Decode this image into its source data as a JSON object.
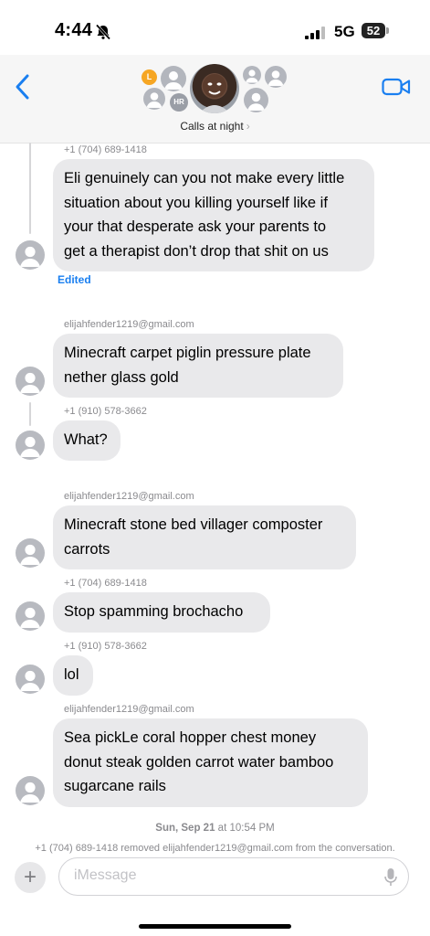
{
  "status_bar": {
    "time": "4:44",
    "network": "5G",
    "battery": "52"
  },
  "header": {
    "group_name": "Calls at night",
    "chevron": "›",
    "initials_badge_1": "L",
    "initials_badge_2": "HR"
  },
  "messages": [
    {
      "sender": "+1 (704) 689-1418",
      "lines": [
        "Eli genuinely can you not make every little",
        "situation about you killing yourself like if",
        "your that desperate ask your parents to",
        "get a therapist don’t drop that shit on us"
      ],
      "edited": "Edited"
    },
    {
      "sender": "elijahfender1219@gmail.com",
      "lines": [
        "Minecraft carpet piglin pressure plate",
        "nether glass gold"
      ]
    },
    {
      "sender": "+1 (910) 578-3662",
      "lines": [
        "What?"
      ]
    },
    {
      "sender": "elijahfender1219@gmail.com",
      "lines": [
        "Minecraft stone bed villager composter",
        "carrots"
      ]
    },
    {
      "sender": "+1 (704) 689-1418",
      "lines": [
        "Stop spamming brochacho"
      ]
    },
    {
      "sender": "+1 (910) 578-3662",
      "lines": [
        "lol"
      ]
    },
    {
      "sender": "elijahfender1219@gmail.com",
      "lines": [
        "Sea pickLe coral  hopper chest money",
        "donut steak golden carrot water bamboo",
        "sugarcane rails"
      ]
    }
  ],
  "timestamp": {
    "date": "Sun, Sep 21",
    "at": "at",
    "time": "10:54 PM"
  },
  "system_message": "+1 (704) 689-1418 removed elijahfender1219@gmail.com from the conversation.",
  "composer": {
    "placeholder": "iMessage",
    "plus_label": "+"
  }
}
